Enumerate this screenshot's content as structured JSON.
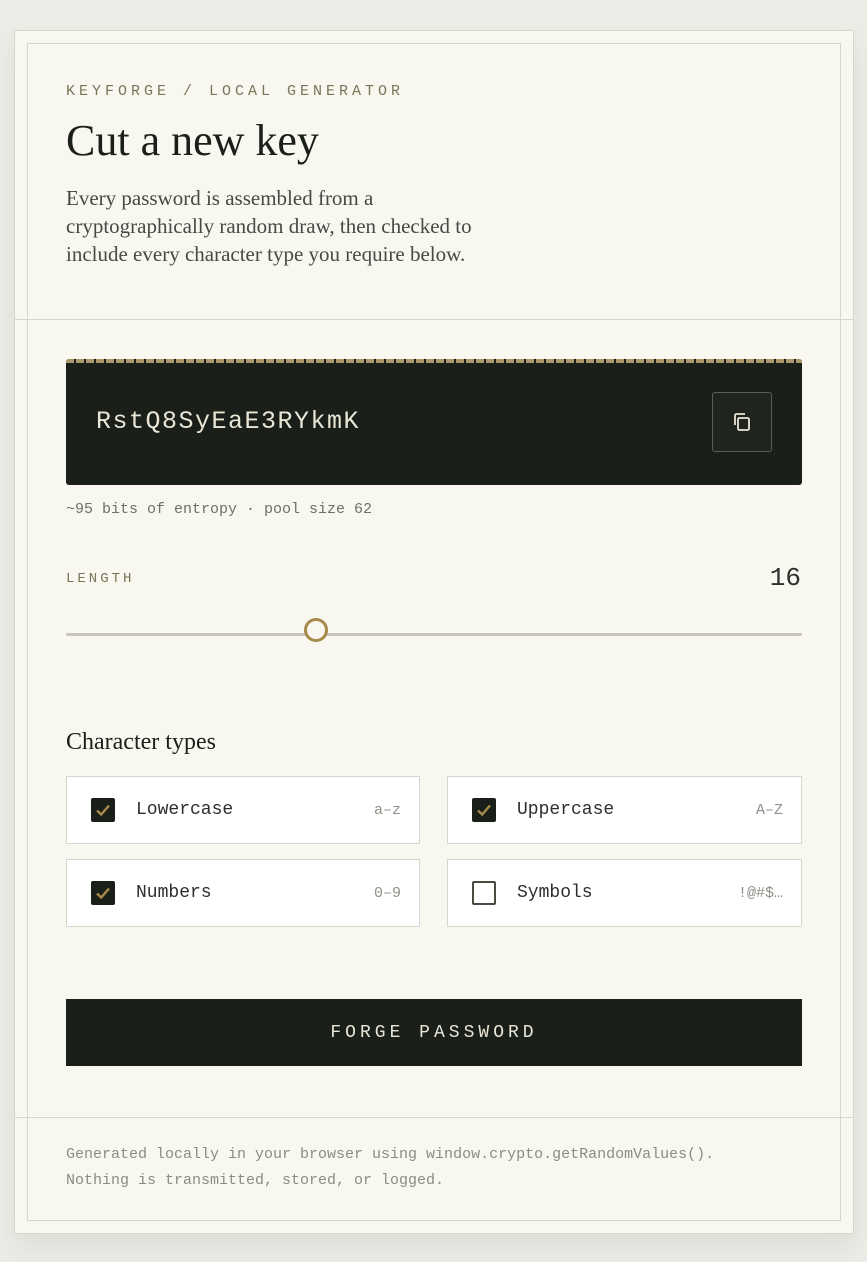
{
  "header": {
    "eyebrow": "KEYFORGE / LOCAL GENERATOR",
    "title": "Cut a new key",
    "description": "Every password is assembled from a cryptographically random draw, then checked to include every character type you require below."
  },
  "password": {
    "value": "RstQ8SyEaE3RYkmK",
    "copy_icon": "copy-icon"
  },
  "entropy": "~95 bits of entropy · pool size 62",
  "length": {
    "label": "LENGTH",
    "value": "16",
    "fraction": 0.34
  },
  "character_types": {
    "title": "Character types",
    "items": [
      {
        "label": "Lowercase",
        "hint": "a–z",
        "checked": true
      },
      {
        "label": "Uppercase",
        "hint": "A–Z",
        "checked": true
      },
      {
        "label": "Numbers",
        "hint": "0–9",
        "checked": true
      },
      {
        "label": "Symbols",
        "hint": "!@#$…",
        "checked": false
      }
    ]
  },
  "forge_button": "FORGE PASSWORD",
  "footer": {
    "line1": "Generated locally in your browser using window.crypto.getRandomValues().",
    "line2": "Nothing is transmitted, stored, or logged."
  },
  "colors": {
    "accent": "#a88a4a",
    "dark": "#1a1f1a",
    "background": "#f8f8f1"
  }
}
